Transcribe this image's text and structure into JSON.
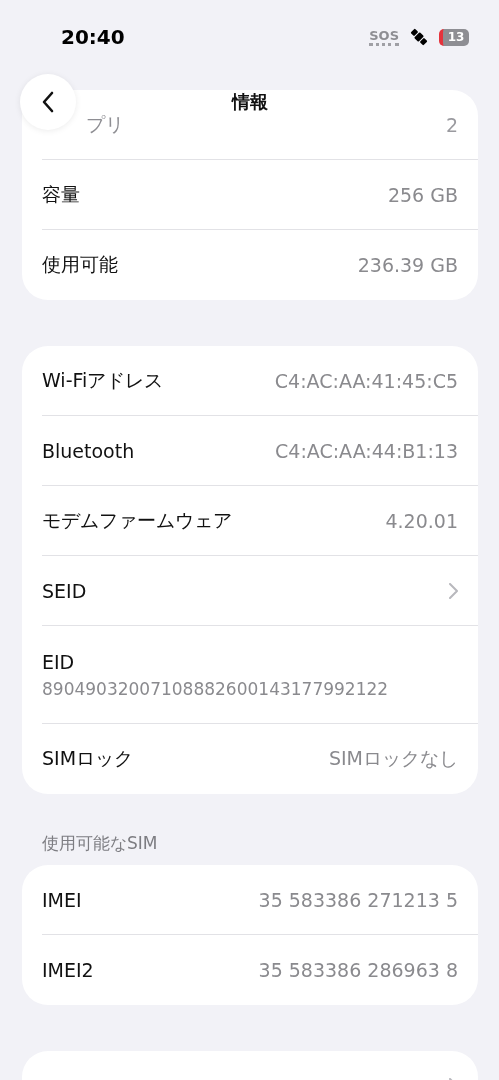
{
  "status_bar": {
    "time": "20:40",
    "sos": "SOS",
    "battery": "13"
  },
  "nav": {
    "title": "情報"
  },
  "groups": [
    {
      "rows": [
        {
          "kind": "value",
          "label": "プリ",
          "value": "2",
          "dimmed": true
        },
        {
          "kind": "value",
          "label": "容量",
          "value": "256 GB"
        },
        {
          "kind": "value",
          "label": "使用可能",
          "value": "236.39 GB"
        }
      ]
    },
    {
      "rows": [
        {
          "kind": "value",
          "label": "Wi-Fiアドレス",
          "value": "C4:AC:AA:41:45:C5"
        },
        {
          "kind": "value",
          "label": "Bluetooth",
          "value": "C4:AC:AA:44:B1:13"
        },
        {
          "kind": "value",
          "label": "モデムファームウェア",
          "value": "4.20.01"
        },
        {
          "kind": "chevron",
          "label": "SEID"
        },
        {
          "kind": "stacked",
          "label": "EID",
          "value": "89049032007108882600143177992122"
        },
        {
          "kind": "value",
          "label": "SIMロック",
          "value": "SIMロックなし"
        }
      ]
    },
    {
      "header": "使用可能なSIM",
      "rows": [
        {
          "kind": "value",
          "label": "IMEI",
          "value": "35 583386 271213 5"
        },
        {
          "kind": "value",
          "label": "IMEI2",
          "value": "35 583386 286963 8"
        }
      ]
    },
    {
      "rows": [
        {
          "kind": "chevron"
        }
      ]
    }
  ]
}
